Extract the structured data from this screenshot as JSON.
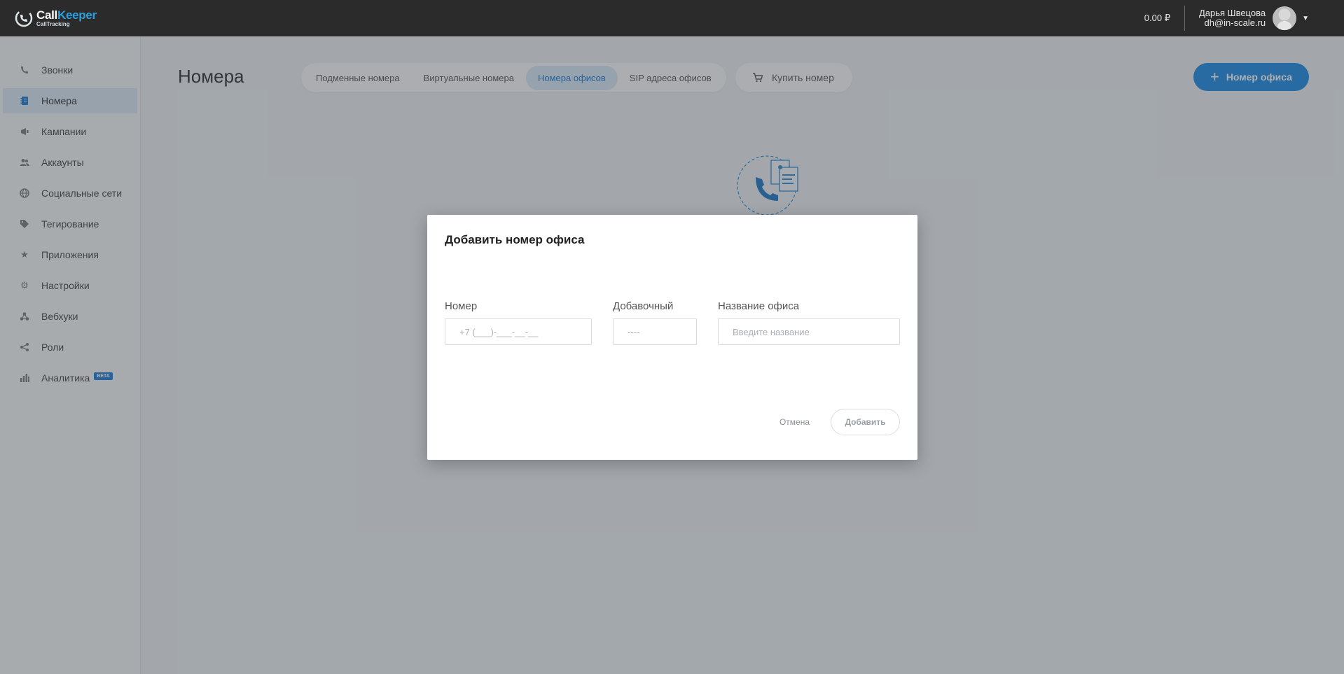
{
  "brand": {
    "name_part1": "Call",
    "name_part2": "Keeper",
    "tagline": "CallTracking"
  },
  "header": {
    "balance": "0.00 ₽",
    "user_name": "Дарья Швецова",
    "user_email": "dh@in-scale.ru"
  },
  "sidebar": {
    "items": [
      {
        "label": "Звонки",
        "icon": "phone-icon"
      },
      {
        "label": "Номера",
        "icon": "notebook-icon",
        "active": true
      },
      {
        "label": "Кампании",
        "icon": "campaign-icon"
      },
      {
        "label": "Аккаунты",
        "icon": "users-icon"
      },
      {
        "label": "Социальные сети",
        "icon": "globe-icon"
      },
      {
        "label": "Тегирование",
        "icon": "tags-icon"
      },
      {
        "label": "Приложения",
        "icon": "star-icon"
      },
      {
        "label": "Настройки",
        "icon": "gear-icon"
      },
      {
        "label": "Вебхуки",
        "icon": "webhook-icon"
      },
      {
        "label": "Роли",
        "icon": "share-icon"
      },
      {
        "label": "Аналитика",
        "icon": "bar-chart-icon",
        "badge": "BETA"
      }
    ]
  },
  "main": {
    "title": "Номера",
    "tabs": [
      {
        "label": "Подменные номера"
      },
      {
        "label": "Виртуальные номера"
      },
      {
        "label": "Номера офисов",
        "active": true
      },
      {
        "label": "SIP адреса офисов"
      }
    ],
    "buy_label": "Купить номер",
    "add_office_label": "Номер офиса"
  },
  "modal": {
    "title": "Добавить номер офиса",
    "number_label": "Номер",
    "number_placeholder": "+7 (___)-___-__-__",
    "ext_label": "Добавочный",
    "ext_placeholder": "----",
    "office_label": "Название офиса",
    "office_placeholder": "Введите название",
    "cancel_label": "Отмена",
    "submit_label": "Добавить"
  },
  "colors": {
    "accent": "#1a8ae6",
    "topbar": "#2b2b2b",
    "active_tab_bg": "#d7e9f8"
  }
}
